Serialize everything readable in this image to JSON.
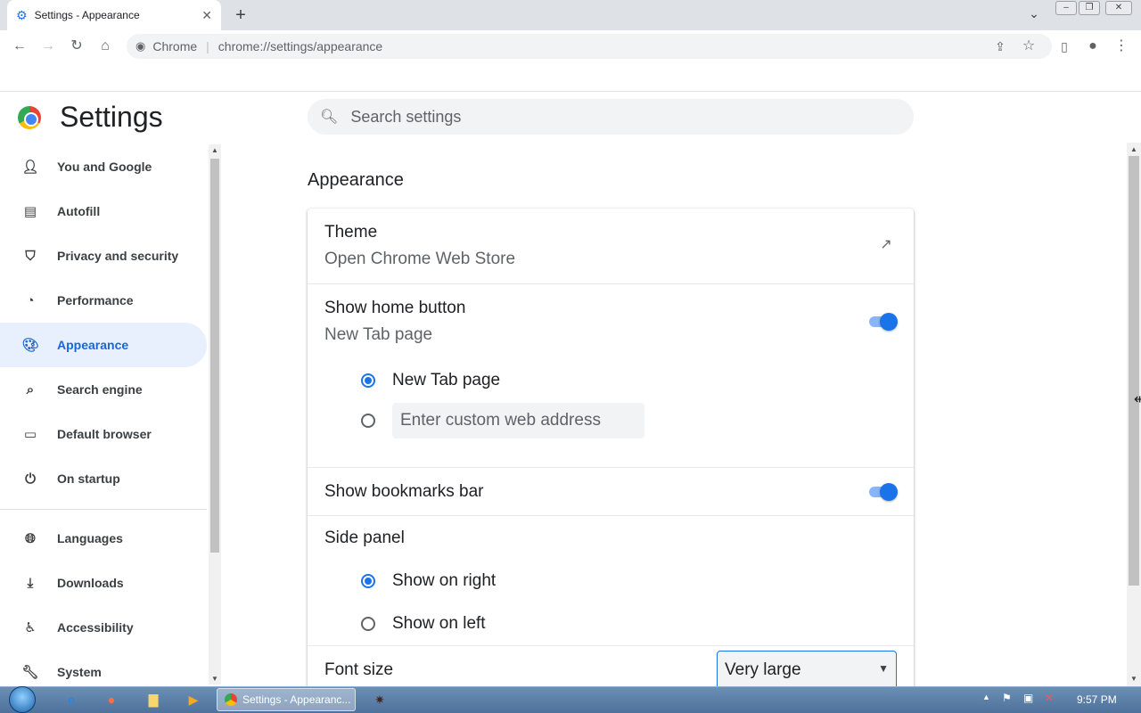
{
  "browser": {
    "tab_title": "Settings - Appearance",
    "tab_close": "✕",
    "new_tab": "+",
    "omnibox_site": "Chrome",
    "omnibox_url": "chrome://settings/appearance"
  },
  "settings": {
    "title": "Settings",
    "search_placeholder": "Search settings"
  },
  "sidebar": {
    "items": [
      {
        "label": "You and Google",
        "icon": "person-icon"
      },
      {
        "label": "Autofill",
        "icon": "clipboard-icon"
      },
      {
        "label": "Privacy and security",
        "icon": "shield-icon"
      },
      {
        "label": "Performance",
        "icon": "speedometer-icon"
      },
      {
        "label": "Appearance",
        "icon": "palette-icon",
        "selected": true
      },
      {
        "label": "Search engine",
        "icon": "search-icon"
      },
      {
        "label": "Default browser",
        "icon": "browser-icon"
      },
      {
        "label": "On startup",
        "icon": "power-icon"
      },
      {
        "label": "Languages",
        "icon": "globe-icon"
      },
      {
        "label": "Downloads",
        "icon": "download-icon"
      },
      {
        "label": "Accessibility",
        "icon": "accessibility-icon"
      },
      {
        "label": "System",
        "icon": "wrench-icon"
      }
    ]
  },
  "appearance": {
    "section_title": "Appearance",
    "theme_label": "Theme",
    "theme_sub": "Open Chrome Web Store",
    "home_label": "Show home button",
    "home_sub": "New Tab page",
    "home_option_newtab": "New Tab page",
    "home_custom_placeholder": "Enter custom web address",
    "bookmarks_label": "Show bookmarks bar",
    "side_panel_label": "Side panel",
    "side_right": "Show on right",
    "side_left": "Show on left",
    "font_size_label": "Font size",
    "font_size_value": "Very large",
    "home_button_enabled": true,
    "bookmarks_enabled": true
  },
  "taskbar": {
    "task_label": "Settings - Appearanc...",
    "clock": "9:57 PM"
  },
  "colors": {
    "accent": "#1a73e8",
    "selected_bg": "#e8f0fe"
  }
}
